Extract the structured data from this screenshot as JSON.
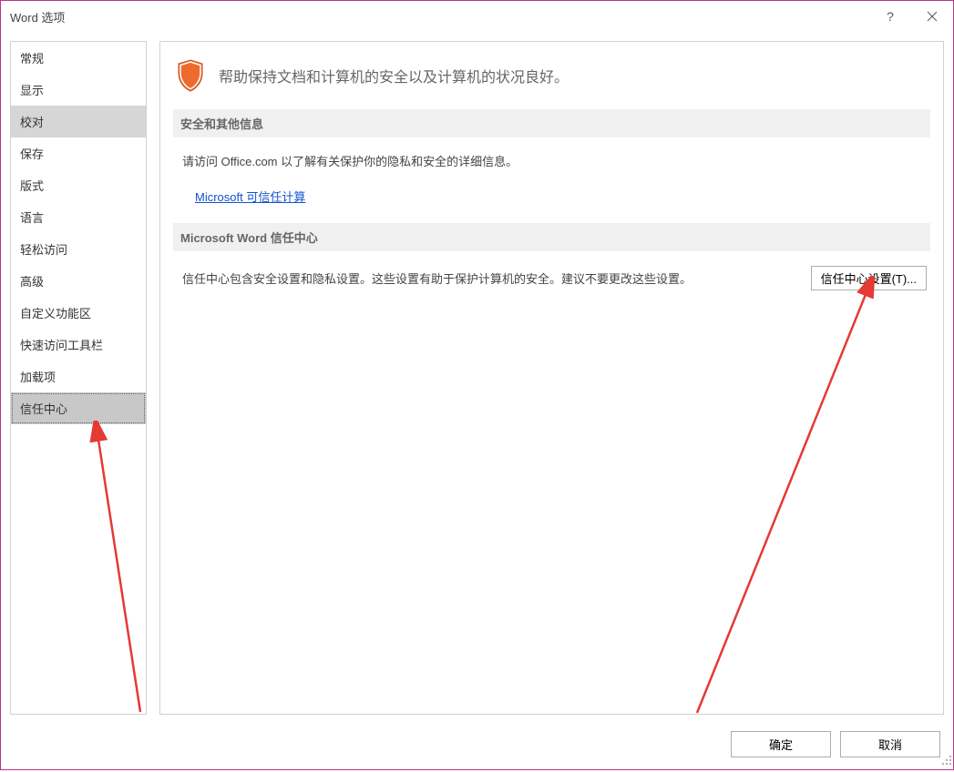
{
  "titlebar": {
    "title": "Word 选项",
    "help": "?"
  },
  "sidebar": {
    "items": [
      "常规",
      "显示",
      "校对",
      "保存",
      "版式",
      "语言",
      "轻松访问",
      "高级",
      "自定义功能区",
      "快速访问工具栏",
      "加载项",
      "信任中心"
    ]
  },
  "main": {
    "headerText": "帮助保持文档和计算机的安全以及计算机的状况良好。",
    "section1": {
      "title": "安全和其他信息",
      "text": "请访问 Office.com 以了解有关保护你的隐私和安全的详细信息。",
      "link": "Microsoft 可信任计算"
    },
    "section2": {
      "title": "Microsoft Word 信任中心",
      "text": "信任中心包含安全设置和隐私设置。这些设置有助于保护计算机的安全。建议不要更改这些设置。",
      "button": "信任中心设置(T)..."
    }
  },
  "footer": {
    "ok": "确定",
    "cancel": "取消"
  }
}
